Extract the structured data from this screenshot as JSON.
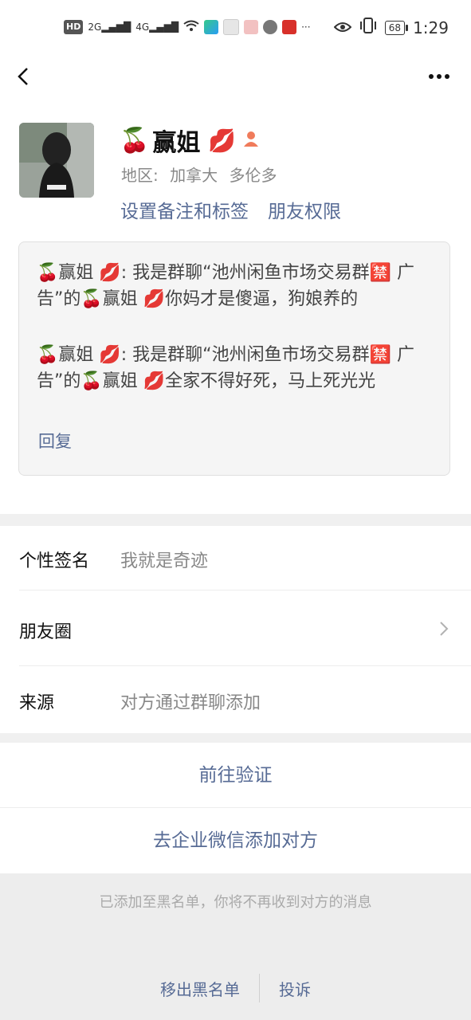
{
  "status_bar": {
    "hd": "HD",
    "net1": "2G",
    "net2": "4G",
    "battery": "68",
    "time": "1:29",
    "more": "···"
  },
  "profile": {
    "name_prefix_emoji": "🍒",
    "name": "赢姐",
    "name_suffix_emoji": "💋",
    "region_label": "地区:",
    "region_country": "加拿大",
    "region_city": "多伦多",
    "link_remark": "设置备注和标签",
    "link_permission": "朋友权限"
  },
  "messages": [
    "🍒赢姐 💋: 我是群聊“池州闲鱼市场交易群🈲 广告”的🍒赢姐 💋你妈才是傻逼，狗娘养的",
    "🍒赢姐 💋: 我是群聊“池州闲鱼市场交易群🈲 广告”的🍒赢姐 💋全家不得好死，马上死光光"
  ],
  "reply_label": "回复",
  "rows": {
    "signature_label": "个性签名",
    "signature_value": "我就是奇迹",
    "moments_label": "朋友圈",
    "source_label": "来源",
    "source_value": "对方通过群聊添加"
  },
  "actions": {
    "verify": "前往验证",
    "enterprise": "去企业微信添加对方"
  },
  "blacklist": {
    "note": "已添加至黑名单，你将不再收到对方的消息",
    "remove": "移出黑名单",
    "report": "投诉"
  },
  "colors": {
    "link": "#576b95",
    "gray_text": "#888888",
    "band": "#f0f0f0"
  }
}
